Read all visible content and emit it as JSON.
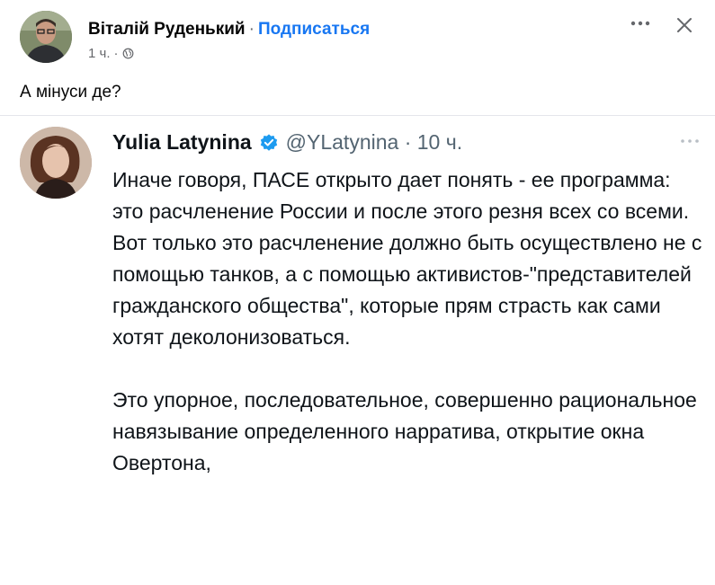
{
  "post": {
    "author": "Віталій Руденький",
    "separator": "·",
    "subscribe_label": "Подписаться",
    "time": "1 ч.",
    "time_sep": "·",
    "text": "А мінуси де?"
  },
  "tweet": {
    "name": "Yulia Latynina",
    "handle_time": "@YLatynina · 10 ч.",
    "paragraphs": [
      "Иначе говоря, ПАСЕ открыто дает понять - ее программа: это расчленение России и после этого резня всех со всеми. Вот только это расчленение должно быть осуществлено не с помощью танков, а с помощью активистов-\"представителей гражданского общества\", которые прям страсть как сами хотят деколонизоваться.",
      "Это упорное, последовательное, совершенно рациональное навязывание определенного нарратива, открытие окна Овертона,"
    ]
  },
  "colors": {
    "link": "#1877f2",
    "secondary_text": "#65676b",
    "verified": "#1d9bf0",
    "handle": "#536471"
  },
  "icons": {
    "globe": "globe-icon",
    "more": "more-horizontal-icon",
    "close": "close-icon",
    "verified": "verified-badge-icon"
  }
}
